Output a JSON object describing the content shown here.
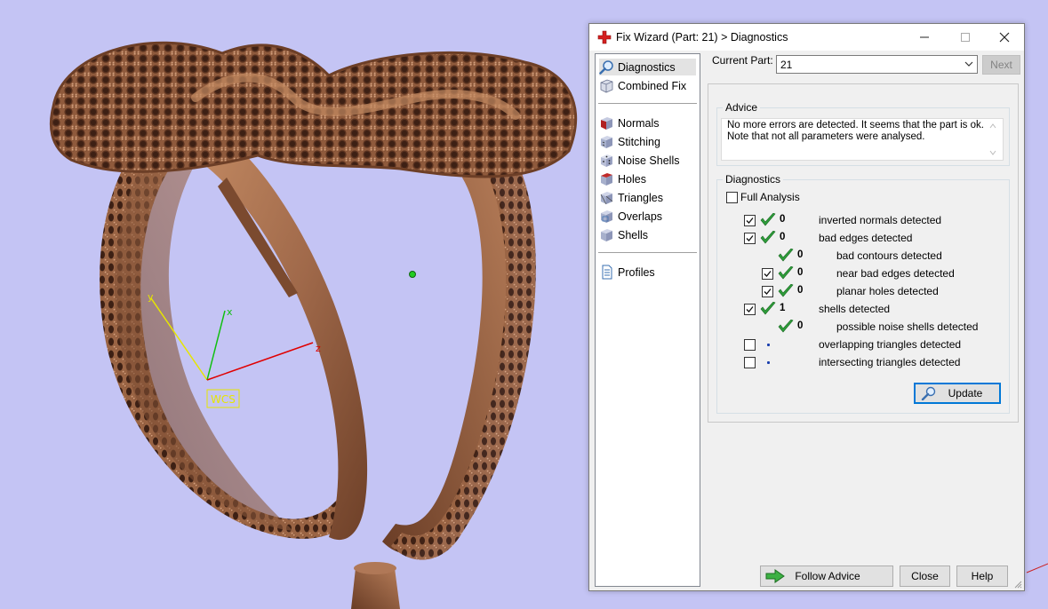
{
  "viewport": {
    "axes": {
      "x": "x",
      "y": "y",
      "z": "z"
    },
    "wcs_label": "WCS",
    "background": "#c4c4f4",
    "model_color": "#a7724d"
  },
  "dialog": {
    "title": "Fix Wizard (Part: 21) > Diagnostics",
    "window_buttons": {
      "minimize": "minimize-icon",
      "maximize": "maximize-icon",
      "close": "close-icon"
    },
    "nav": {
      "top_items": [
        {
          "label": "Diagnostics",
          "icon": "magnifier-icon",
          "selected": true
        },
        {
          "label": "Combined Fix",
          "icon": "cube-icon",
          "selected": false
        }
      ],
      "tool_items": [
        {
          "label": "Normals",
          "icon": "normals-cube-icon"
        },
        {
          "label": "Stitching",
          "icon": "stitching-cube-icon"
        },
        {
          "label": "Noise Shells",
          "icon": "dice-icon"
        },
        {
          "label": "Holes",
          "icon": "holes-cube-icon"
        },
        {
          "label": "Triangles",
          "icon": "triangles-cube-icon"
        },
        {
          "label": "Overlaps",
          "icon": "overlaps-cube-icon"
        },
        {
          "label": "Shells",
          "icon": "shells-cube-icon"
        }
      ],
      "bottom_items": [
        {
          "label": "Profiles",
          "icon": "document-icon"
        }
      ]
    },
    "current_part_label": "Current Part:",
    "current_part_value": "21",
    "next_label": "Next",
    "advice": {
      "title": "Advice",
      "text": "No more errors are detected. It seems that the part is ok. Note that not all parameters were analysed."
    },
    "diagnostics": {
      "title": "Diagnostics",
      "full_analysis_label": "Full Analysis",
      "full_analysis_checked": false,
      "rows": [
        {
          "checkbox": true,
          "checked": true,
          "status": "ok",
          "count": "0",
          "label": "inverted normals detected",
          "indent": 0
        },
        {
          "checkbox": true,
          "checked": true,
          "status": "ok",
          "count": "0",
          "label": "bad edges detected",
          "indent": 0
        },
        {
          "checkbox": false,
          "checked": false,
          "status": "ok",
          "count": "0",
          "label": "bad contours detected",
          "indent": 1
        },
        {
          "checkbox": true,
          "checked": true,
          "status": "ok",
          "count": "0",
          "label": "near bad edges detected",
          "indent": 1
        },
        {
          "checkbox": true,
          "checked": true,
          "status": "ok",
          "count": "0",
          "label": "planar holes detected",
          "indent": 1
        },
        {
          "checkbox": true,
          "checked": true,
          "status": "ok",
          "count": "1",
          "label": "shells detected",
          "indent": 0
        },
        {
          "checkbox": false,
          "checked": false,
          "status": "ok",
          "count": "0",
          "label": "possible noise shells detected",
          "indent": 1
        },
        {
          "checkbox": true,
          "checked": false,
          "status": "none",
          "count": "",
          "label": "overlapping triangles detected",
          "indent": 0
        },
        {
          "checkbox": true,
          "checked": false,
          "status": "none",
          "count": "",
          "label": "intersecting triangles detected",
          "indent": 0
        }
      ],
      "update_label": "Update"
    },
    "footer": {
      "follow_advice_label": "Follow Advice",
      "close_label": "Close",
      "help_label": "Help"
    }
  }
}
